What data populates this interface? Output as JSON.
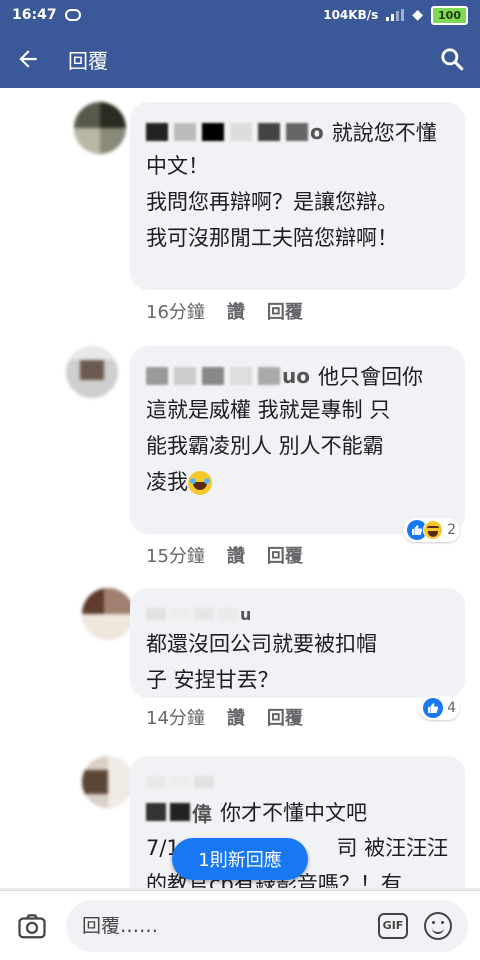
{
  "status_bar": {
    "time": "16:47",
    "network_speed": "104KB/s",
    "battery": "100"
  },
  "app_bar": {
    "title": "回覆"
  },
  "comments": [
    {
      "name_suffix": "o",
      "first_line": "就說您不懂",
      "lines": [
        "中文！",
        "我問您再辯啊？是讓您辯。",
        "我可沒那閒工夫陪您辯啊！"
      ],
      "time": "16分鐘",
      "like": "讚",
      "reply": "回覆"
    },
    {
      "name_suffix": "uo",
      "first_line": "他只會回你",
      "lines": [
        "這就是威權 我就是專制 只",
        "能我霸凌別人 別人不能霸"
      ],
      "last_line": "凌我",
      "time": "15分鐘",
      "like": "讚",
      "reply": "回覆",
      "reaction_count": "2"
    },
    {
      "name_suffix": "u",
      "lines": [
        "都還沒回公司就要被扣帽",
        "子 安捏甘丟？"
      ],
      "time": "14分鐘",
      "like": "讚",
      "reply": "回覆",
      "reaction_count": "4"
    },
    {
      "name_suffix": "偉",
      "first_line": "你才不懂中文吧",
      "lines": [
        "7/1",
        "的教官cb有錄影音嗎？！有"
      ],
      "line2_tail": "司 被汪汪汪"
    }
  ],
  "new_reply_button": "1則新回應",
  "composer": {
    "placeholder": "回覆……",
    "gif_label": "GIF"
  },
  "colors": {
    "brand": "#3b5998",
    "accent": "#1877f2",
    "bubble": "#f0f2f5"
  }
}
